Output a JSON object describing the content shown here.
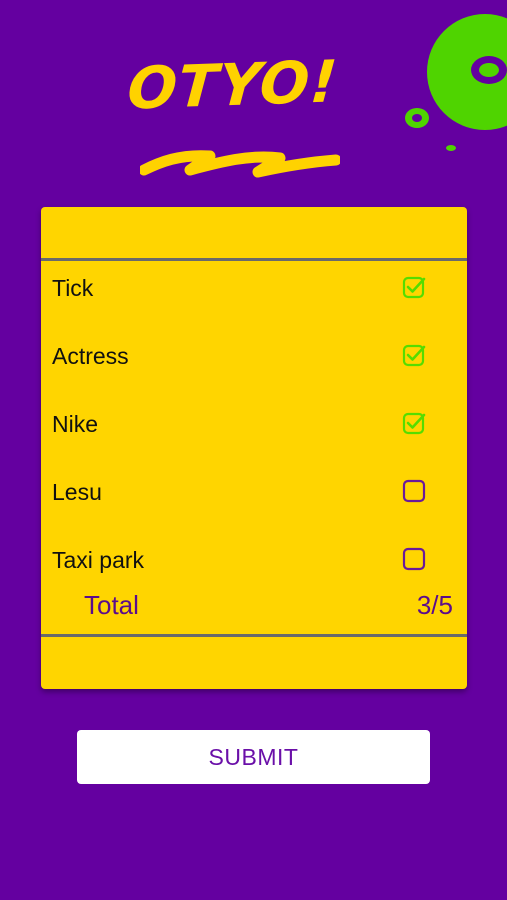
{
  "app": {
    "logo_text": "OTYO!"
  },
  "colors": {
    "background": "#6400a0",
    "card": "#ffd500",
    "accent_green": "#55dd00",
    "total_text": "#5b0c8c",
    "checkbox_unchecked": "#6a1a9a"
  },
  "checklist": {
    "items": [
      {
        "label": "Tick",
        "checked": true,
        "icon": "checkbox-checked-icon"
      },
      {
        "label": "Actress",
        "checked": true,
        "icon": "checkbox-checked-icon"
      },
      {
        "label": "Nike",
        "checked": true,
        "icon": "checkbox-checked-icon"
      },
      {
        "label": "Lesu",
        "checked": false,
        "icon": "checkbox-empty-icon"
      },
      {
        "label": "Taxi park",
        "checked": false,
        "icon": "checkbox-empty-icon"
      }
    ],
    "total_label": "Total",
    "total_value": "3/5"
  },
  "actions": {
    "submit_label": "SUBMIT"
  }
}
